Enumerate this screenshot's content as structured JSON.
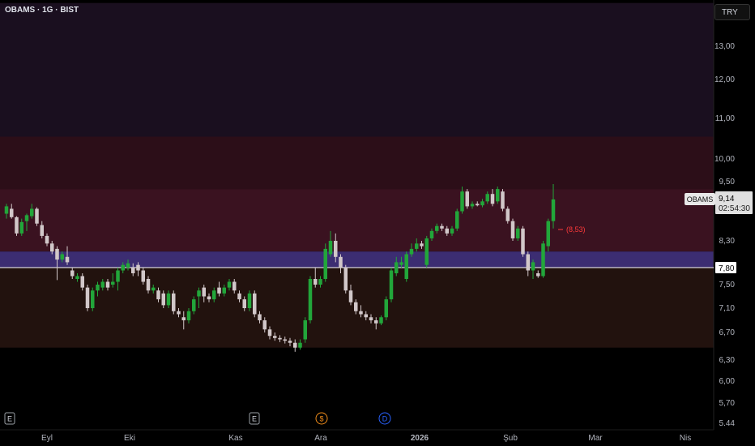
{
  "header": {
    "symbol_title": "OBAMS · 1G · BIST",
    "currency": "TRY"
  },
  "colors": {
    "up": "#22a63a",
    "down": "#d1c7c9",
    "annotation": "#ff3a3a",
    "line": "#ffffff"
  },
  "zones": [
    {
      "from": 10.55,
      "to": 14.3,
      "color": "#1a0f1f"
    },
    {
      "from": 9.35,
      "to": 10.55,
      "color": "#2c0e18"
    },
    {
      "from": 8.1,
      "to": 9.35,
      "color": "#3a1220"
    },
    {
      "from": 7.8,
      "to": 8.1,
      "color": "#3c2d72"
    },
    {
      "from": 6.48,
      "to": 7.8,
      "color": "#22120e"
    }
  ],
  "chart_data": {
    "type": "candlestick",
    "x_labels": [
      "Eyl",
      "Eki",
      "Kas",
      "Ara",
      "2026",
      "Şub",
      "Mar",
      "Nis"
    ],
    "y_ticks": [
      "13,00",
      "12,00",
      "11,00",
      "10,00",
      "9,50",
      "8,30",
      "7,80",
      "7,50",
      "7,10",
      "6,70",
      "6,30",
      "6,00",
      "5,70",
      "5.44"
    ],
    "price_label": {
      "symbol": "OBAMS",
      "price": "9,14",
      "countdown": "02:54:30"
    },
    "horizontal_line": {
      "value": 7.8,
      "label": "7,80"
    },
    "annotation": "(8,53)",
    "event_markers": [
      "E",
      "E",
      "$",
      "D"
    ],
    "candles": [
      {
        "o": 8.85,
        "h": 9.05,
        "l": 8.75,
        "c": 9.0
      },
      {
        "o": 8.95,
        "h": 9.05,
        "l": 8.75,
        "c": 8.78
      },
      {
        "o": 8.78,
        "h": 8.8,
        "l": 8.4,
        "c": 8.45
      },
      {
        "o": 8.45,
        "h": 8.75,
        "l": 8.4,
        "c": 8.68
      },
      {
        "o": 8.7,
        "h": 8.85,
        "l": 8.5,
        "c": 8.82
      },
      {
        "o": 8.8,
        "h": 9.05,
        "l": 8.75,
        "c": 8.95
      },
      {
        "o": 8.95,
        "h": 8.98,
        "l": 8.6,
        "c": 8.65
      },
      {
        "o": 8.62,
        "h": 8.7,
        "l": 8.35,
        "c": 8.4
      },
      {
        "o": 8.4,
        "h": 8.45,
        "l": 8.2,
        "c": 8.25
      },
      {
        "o": 8.25,
        "h": 8.3,
        "l": 8.05,
        "c": 8.1
      },
      {
        "o": 8.15,
        "h": 8.2,
        "l": 7.58,
        "c": 7.95
      },
      {
        "o": 7.95,
        "h": 8.1,
        "l": 7.9,
        "c": 8.05
      },
      {
        "o": 8.0,
        "h": 8.2,
        "l": 7.85,
        "c": 7.9
      },
      {
        "o": 7.75,
        "h": 7.8,
        "l": 7.6,
        "c": 7.65
      },
      {
        "o": 7.6,
        "h": 7.7,
        "l": 7.55,
        "c": 7.65
      },
      {
        "o": 7.65,
        "h": 7.7,
        "l": 7.4,
        "c": 7.45
      },
      {
        "o": 7.45,
        "h": 7.5,
        "l": 7.05,
        "c": 7.1
      },
      {
        "o": 7.1,
        "h": 7.45,
        "l": 7.05,
        "c": 7.4
      },
      {
        "o": 7.4,
        "h": 7.55,
        "l": 7.3,
        "c": 7.5
      },
      {
        "o": 7.45,
        "h": 7.6,
        "l": 7.4,
        "c": 7.55
      },
      {
        "o": 7.55,
        "h": 7.6,
        "l": 7.4,
        "c": 7.45
      },
      {
        "o": 7.5,
        "h": 7.7,
        "l": 7.45,
        "c": 7.55
      },
      {
        "o": 7.55,
        "h": 7.8,
        "l": 7.4,
        "c": 7.75
      },
      {
        "o": 7.75,
        "h": 7.9,
        "l": 7.7,
        "c": 7.85
      },
      {
        "o": 7.8,
        "h": 7.95,
        "l": 7.75,
        "c": 7.88
      },
      {
        "o": 7.8,
        "h": 7.88,
        "l": 7.65,
        "c": 7.7
      },
      {
        "o": 7.85,
        "h": 7.9,
        "l": 7.65,
        "c": 7.75
      },
      {
        "o": 7.75,
        "h": 7.8,
        "l": 7.5,
        "c": 7.55
      },
      {
        "o": 7.6,
        "h": 7.65,
        "l": 7.35,
        "c": 7.4
      },
      {
        "o": 7.4,
        "h": 7.5,
        "l": 7.35,
        "c": 7.45
      },
      {
        "o": 7.4,
        "h": 7.45,
        "l": 7.2,
        "c": 7.25
      },
      {
        "o": 7.35,
        "h": 7.4,
        "l": 7.1,
        "c": 7.15
      },
      {
        "o": 7.15,
        "h": 7.4,
        "l": 7.1,
        "c": 7.35
      },
      {
        "o": 7.35,
        "h": 7.4,
        "l": 7.0,
        "c": 7.05
      },
      {
        "o": 7.05,
        "h": 7.1,
        "l": 6.95,
        "c": 7.0
      },
      {
        "o": 6.95,
        "h": 7.05,
        "l": 6.75,
        "c": 6.9
      },
      {
        "o": 6.9,
        "h": 7.1,
        "l": 6.85,
        "c": 7.05
      },
      {
        "o": 7.05,
        "h": 7.3,
        "l": 7.0,
        "c": 7.25
      },
      {
        "o": 7.3,
        "h": 7.45,
        "l": 7.1,
        "c": 7.4
      },
      {
        "o": 7.45,
        "h": 7.5,
        "l": 7.2,
        "c": 7.3
      },
      {
        "o": 7.3,
        "h": 7.35,
        "l": 7.2,
        "c": 7.25
      },
      {
        "o": 7.25,
        "h": 7.45,
        "l": 7.2,
        "c": 7.4
      },
      {
        "o": 7.45,
        "h": 7.55,
        "l": 7.3,
        "c": 7.35
      },
      {
        "o": 7.35,
        "h": 7.5,
        "l": 7.3,
        "c": 7.45
      },
      {
        "o": 7.45,
        "h": 7.6,
        "l": 7.4,
        "c": 7.55
      },
      {
        "o": 7.55,
        "h": 7.6,
        "l": 7.35,
        "c": 7.4
      },
      {
        "o": 7.35,
        "h": 7.4,
        "l": 7.2,
        "c": 7.25
      },
      {
        "o": 7.25,
        "h": 7.3,
        "l": 7.05,
        "c": 7.1
      },
      {
        "o": 7.1,
        "h": 7.4,
        "l": 7.05,
        "c": 7.35
      },
      {
        "o": 7.35,
        "h": 7.4,
        "l": 6.95,
        "c": 7.0
      },
      {
        "o": 7.0,
        "h": 7.05,
        "l": 6.85,
        "c": 6.9
      },
      {
        "o": 6.9,
        "h": 6.95,
        "l": 6.7,
        "c": 6.75
      },
      {
        "o": 6.75,
        "h": 6.8,
        "l": 6.6,
        "c": 6.65
      },
      {
        "o": 6.65,
        "h": 6.7,
        "l": 6.58,
        "c": 6.62
      },
      {
        "o": 6.62,
        "h": 6.66,
        "l": 6.56,
        "c": 6.6
      },
      {
        "o": 6.6,
        "h": 6.64,
        "l": 6.54,
        "c": 6.58
      },
      {
        "o": 6.58,
        "h": 6.62,
        "l": 6.5,
        "c": 6.55
      },
      {
        "o": 6.55,
        "h": 6.6,
        "l": 6.42,
        "c": 6.48
      },
      {
        "o": 6.48,
        "h": 6.6,
        "l": 6.45,
        "c": 6.55
      },
      {
        "o": 6.6,
        "h": 6.95,
        "l": 6.55,
        "c": 6.9
      },
      {
        "o": 6.9,
        "h": 7.65,
        "l": 6.85,
        "c": 7.6
      },
      {
        "o": 7.6,
        "h": 7.8,
        "l": 7.45,
        "c": 7.5
      },
      {
        "o": 7.5,
        "h": 7.65,
        "l": 7.45,
        "c": 7.6
      },
      {
        "o": 7.6,
        "h": 8.25,
        "l": 7.55,
        "c": 8.15
      },
      {
        "o": 8.05,
        "h": 8.5,
        "l": 8.0,
        "c": 8.3
      },
      {
        "o": 8.3,
        "h": 8.45,
        "l": 7.9,
        "c": 8.0
      },
      {
        "o": 8.0,
        "h": 8.05,
        "l": 7.7,
        "c": 7.8
      },
      {
        "o": 7.8,
        "h": 7.85,
        "l": 7.35,
        "c": 7.4
      },
      {
        "o": 7.4,
        "h": 7.5,
        "l": 7.15,
        "c": 7.2
      },
      {
        "o": 7.2,
        "h": 7.25,
        "l": 7.0,
        "c": 7.05
      },
      {
        "o": 7.05,
        "h": 7.15,
        "l": 6.95,
        "c": 7.0
      },
      {
        "o": 7.0,
        "h": 7.05,
        "l": 6.9,
        "c": 6.95
      },
      {
        "o": 6.95,
        "h": 7.0,
        "l": 6.85,
        "c": 6.9
      },
      {
        "o": 6.9,
        "h": 6.95,
        "l": 6.75,
        "c": 6.85
      },
      {
        "o": 6.85,
        "h": 6.98,
        "l": 6.82,
        "c": 6.95
      },
      {
        "o": 6.95,
        "h": 7.3,
        "l": 6.9,
        "c": 7.25
      },
      {
        "o": 7.25,
        "h": 7.8,
        "l": 7.2,
        "c": 7.75
      },
      {
        "o": 7.7,
        "h": 8.0,
        "l": 7.65,
        "c": 7.9
      },
      {
        "o": 7.85,
        "h": 8.0,
        "l": 7.8,
        "c": 7.9
      },
      {
        "o": 7.6,
        "h": 8.1,
        "l": 7.55,
        "c": 8.05
      },
      {
        "o": 8.05,
        "h": 8.25,
        "l": 8.0,
        "c": 8.15
      },
      {
        "o": 8.15,
        "h": 8.35,
        "l": 8.1,
        "c": 8.25
      },
      {
        "o": 8.25,
        "h": 8.3,
        "l": 8.15,
        "c": 8.2
      },
      {
        "o": 7.85,
        "h": 8.4,
        "l": 7.8,
        "c": 8.35
      },
      {
        "o": 8.35,
        "h": 8.55,
        "l": 8.3,
        "c": 8.5
      },
      {
        "o": 8.5,
        "h": 8.65,
        "l": 8.45,
        "c": 8.6
      },
      {
        "o": 8.6,
        "h": 8.65,
        "l": 8.5,
        "c": 8.55
      },
      {
        "o": 8.55,
        "h": 8.6,
        "l": 8.4,
        "c": 8.45
      },
      {
        "o": 8.45,
        "h": 8.6,
        "l": 8.4,
        "c": 8.55
      },
      {
        "o": 8.55,
        "h": 8.95,
        "l": 8.5,
        "c": 8.9
      },
      {
        "o": 8.9,
        "h": 9.4,
        "l": 8.85,
        "c": 9.3
      },
      {
        "o": 9.3,
        "h": 9.35,
        "l": 8.95,
        "c": 9.0
      },
      {
        "o": 9.0,
        "h": 9.1,
        "l": 8.95,
        "c": 9.05
      },
      {
        "o": 9.05,
        "h": 9.1,
        "l": 9.0,
        "c": 9.02
      },
      {
        "o": 9.02,
        "h": 9.15,
        "l": 8.98,
        "c": 9.1
      },
      {
        "o": 9.1,
        "h": 9.3,
        "l": 9.05,
        "c": 9.25
      },
      {
        "o": 9.25,
        "h": 9.35,
        "l": 9.0,
        "c": 9.05
      },
      {
        "o": 9.1,
        "h": 9.4,
        "l": 9.05,
        "c": 9.35
      },
      {
        "o": 9.3,
        "h": 9.35,
        "l": 8.9,
        "c": 8.95
      },
      {
        "o": 8.95,
        "h": 9.0,
        "l": 8.65,
        "c": 8.7
      },
      {
        "o": 8.7,
        "h": 8.75,
        "l": 8.3,
        "c": 8.35
      },
      {
        "o": 8.35,
        "h": 8.6,
        "l": 8.3,
        "c": 8.55
      },
      {
        "o": 8.55,
        "h": 8.6,
        "l": 8.0,
        "c": 8.05
      },
      {
        "o": 8.05,
        "h": 8.1,
        "l": 7.65,
        "c": 7.75
      },
      {
        "o": 7.75,
        "h": 7.95,
        "l": 7.6,
        "c": 7.9
      },
      {
        "o": 7.7,
        "h": 7.75,
        "l": 7.62,
        "c": 7.65
      },
      {
        "o": 7.65,
        "h": 8.3,
        "l": 7.62,
        "c": 8.25
      },
      {
        "o": 8.2,
        "h": 8.75,
        "l": 8.1,
        "c": 8.7
      },
      {
        "o": 8.7,
        "h": 9.45,
        "l": 8.55,
        "c": 9.14
      }
    ]
  }
}
